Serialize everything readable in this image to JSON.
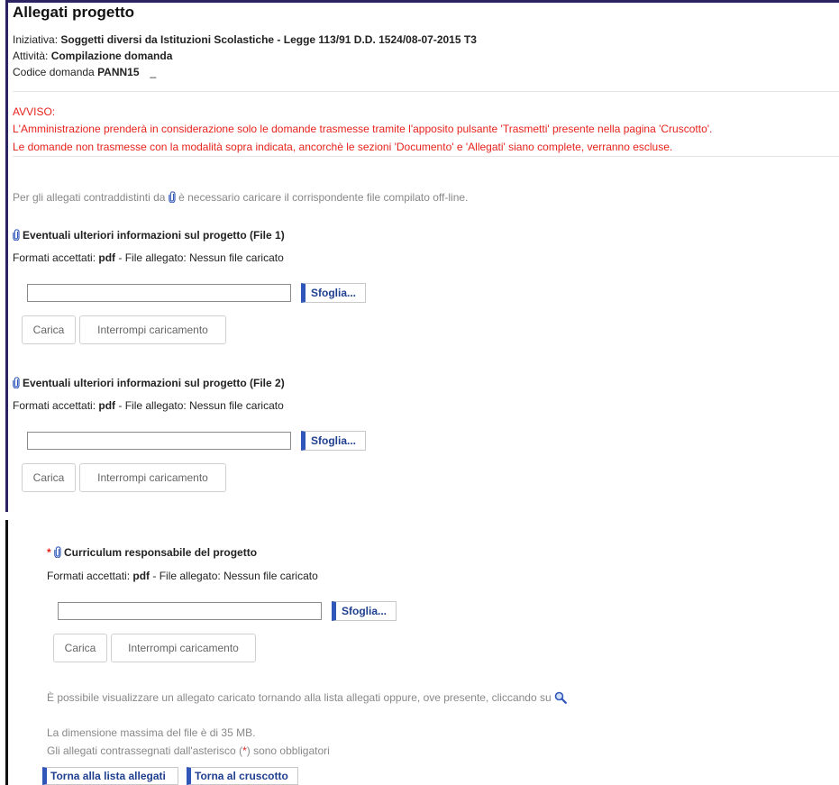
{
  "page": {
    "title": "Allegati progetto",
    "initiative_label": "Iniziativa: ",
    "initiative_value": "Soggetti diversi da Istituzioni Scolastiche - Legge 113/91 D.D. 1524/08-07-2015 T3",
    "activity_label": "Attività: ",
    "activity_value": "Compilazione domanda",
    "code_label": "Codice domanda ",
    "code_value": "PANN15",
    "code_suffix": "_"
  },
  "warning": {
    "heading": "AVVISO:",
    "line1": "L'Amministrazione prenderà in considerazione solo le domande trasmesse tramite l'apposito pulsante 'Trasmetti' presente nella pagina 'Cruscotto'.",
    "line2": "Le domande non trasmesse con la modalità sopra indicata, ancorchè le sezioni 'Documento' e 'Allegati' siano complete, verranno escluse."
  },
  "intro": {
    "before": "Per gli allegati contraddistinti da ",
    "after": " è necessario caricare il corrispondente file compilato off-line."
  },
  "sections": [
    {
      "title": "Eventuali ulteriori informazioni sul progetto (File 1)",
      "formats_label": "Formati accettati: ",
      "formats_value": "pdf",
      "file_status": " - File allegato: Nessun file caricato",
      "browse_label": "Sfoglia...",
      "upload_label": "Carica",
      "abort_label": "Interrompi caricamento"
    },
    {
      "title": "Eventuali ulteriori informazioni sul progetto (File 2)",
      "formats_label": "Formati accettati: ",
      "formats_value": "pdf",
      "file_status": " - File allegato: Nessun file caricato",
      "browse_label": "Sfoglia...",
      "upload_label": "Carica",
      "abort_label": "Interrompi caricamento"
    },
    {
      "required_mark": "*",
      "title": "Curriculum responsabile del progetto",
      "formats_label": "Formati accettati: ",
      "formats_value": "pdf",
      "file_status": " - File allegato: Nessun file caricato",
      "browse_label": "Sfoglia...",
      "upload_label": "Carica",
      "abort_label": "Interrompi caricamento"
    }
  ],
  "footer": {
    "view_note": "È possibile visualizzare un allegato caricato tornando alla lista allegati oppure, ove presente, cliccando su",
    "max_size": "La dimensione massima del file è di 35 MB.",
    "required_before": "Gli allegati contrassegnati dall'asterisco (",
    "required_mark": "*",
    "required_after": ") sono obbligatori",
    "back_to_list": "Torna alla lista allegati",
    "back_to_dashboard": "Torna al cruscotto"
  },
  "colors": {
    "accent": "#2f56b8",
    "warning": "#e8231d",
    "frame": "#2b2460"
  },
  "icons": {
    "attachment": "paperclip-icon",
    "search": "magnifier-icon"
  }
}
